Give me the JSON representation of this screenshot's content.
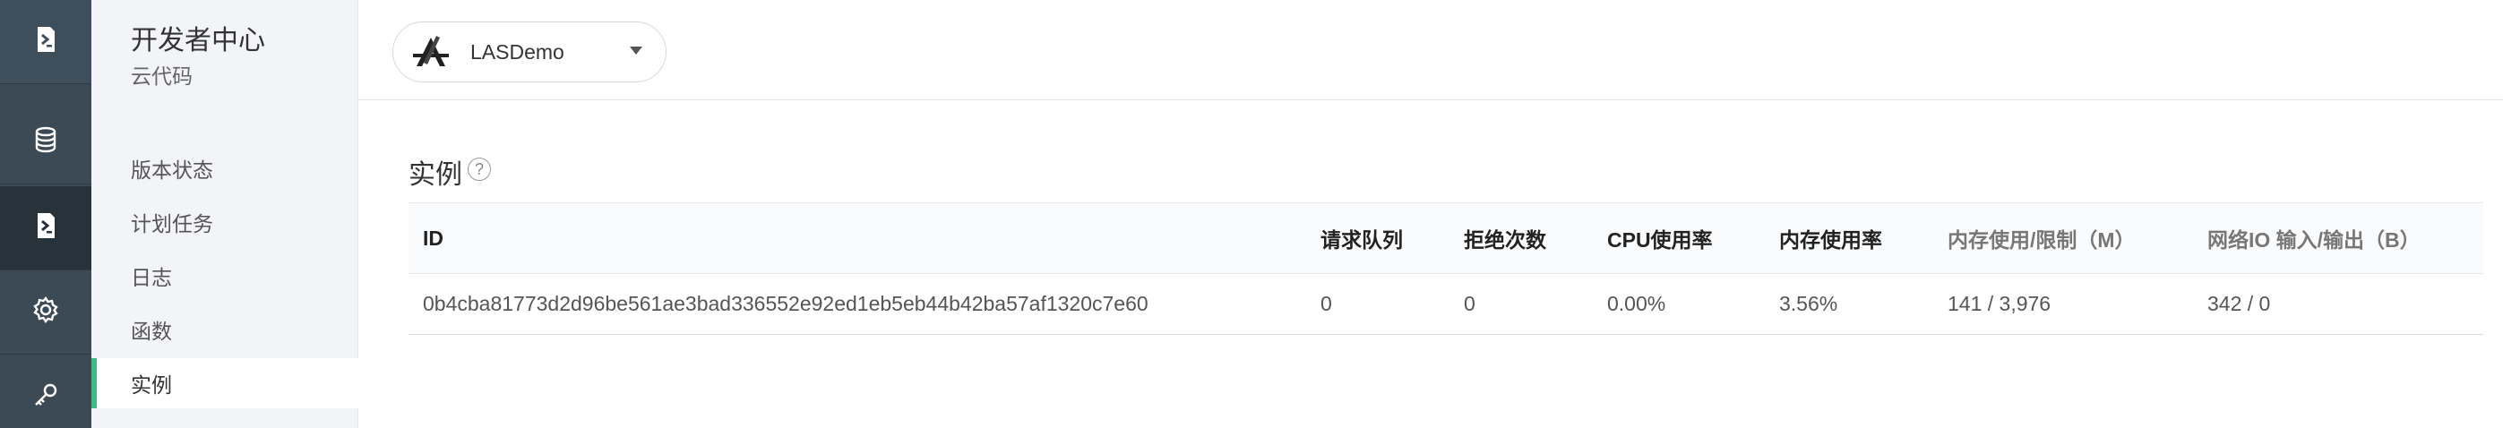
{
  "sidebar": {
    "title": "开发者中心",
    "subtitle": "云代码",
    "items": [
      {
        "label": "版本状态"
      },
      {
        "label": "计划任务"
      },
      {
        "label": "日志"
      },
      {
        "label": "函数"
      },
      {
        "label": "实例"
      }
    ],
    "active_item": "实例"
  },
  "rail": {
    "icons": [
      "cloud-code-icon",
      "database-icon",
      "cloud-code-active-icon",
      "settings-gear-icon",
      "key-icon"
    ]
  },
  "topbar": {
    "app_name": "LASDemo"
  },
  "main": {
    "title": "实例",
    "help": "?",
    "table": {
      "headers": [
        "ID",
        "请求队列",
        "拒绝次数",
        "CPU使用率",
        "内存使用率",
        "内存使用/限制（M）",
        "网络IO 输入/输出（B）"
      ],
      "rows": [
        [
          "0b4cba81773d2d96be561ae3bad336552e92ed1eb5eb44b42ba57af1320c7e60",
          "0",
          "0",
          "0.00%",
          "3.56%",
          "141 / 3,976",
          "342 / 0"
        ]
      ]
    }
  },
  "colors": {
    "rail_bg": "#3c4a56",
    "rail_active_bg": "#28323b",
    "sidebar_bg": "#f3f4f7",
    "active_accent": "#3dbd7d"
  }
}
